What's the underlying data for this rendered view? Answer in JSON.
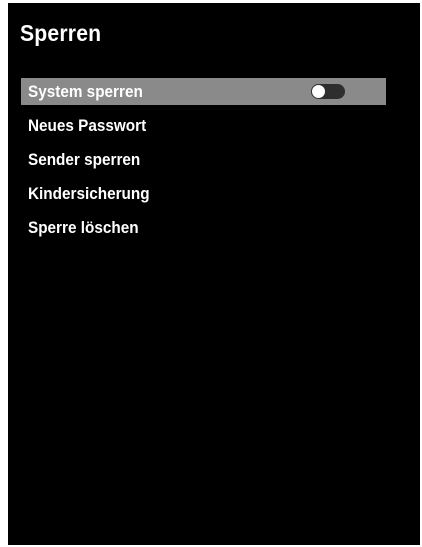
{
  "title": "Sperren",
  "menu": {
    "items": [
      {
        "label": "System sperren",
        "selected": true,
        "toggle": {
          "state": "off"
        }
      },
      {
        "label": "Neues Passwort",
        "selected": false
      },
      {
        "label": "Sender sperren",
        "selected": false
      },
      {
        "label": "Kindersicherung",
        "selected": false
      },
      {
        "label": "Sperre löschen",
        "selected": false
      }
    ]
  },
  "colors": {
    "background": "#000000",
    "highlight": "#8a8a8a",
    "text": "#ffffff"
  }
}
